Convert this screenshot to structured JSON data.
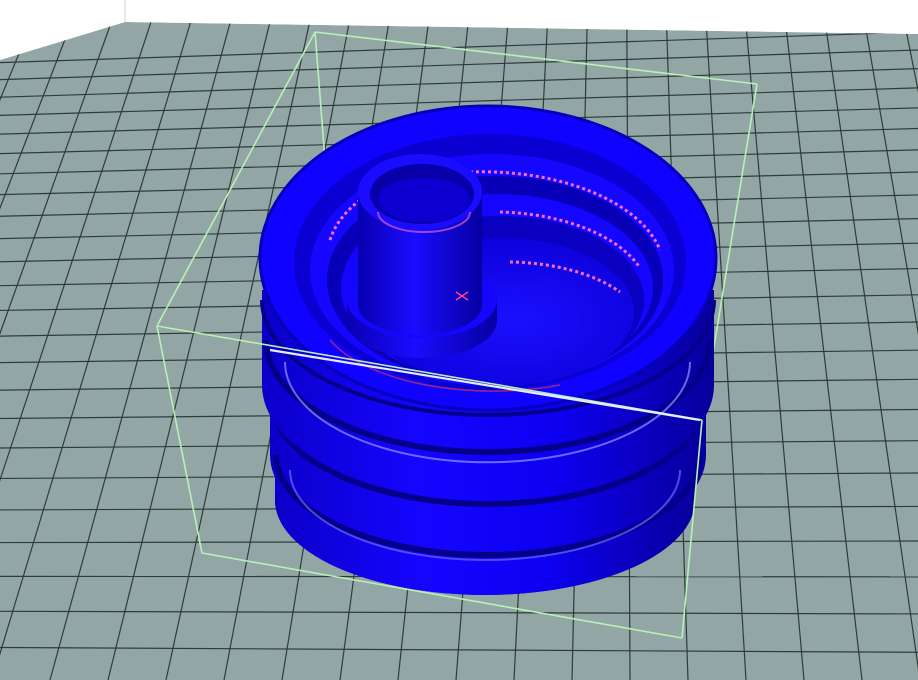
{
  "viewport": {
    "kind": "3d-print-preview",
    "background_color": "#ffffff",
    "bed_color": "#93a6a6",
    "grid_line_color": "#2f3b3b",
    "bounding_box_color": "#b8f0b8",
    "model_color": "#0b00ff",
    "model_shade_color": "#06009a",
    "overhang_highlight_color": "#ff6bd0",
    "highlight_line_color": "#dfe6ff"
  },
  "model": {
    "description_icon": "threaded-cap-with-center-tube-icon"
  }
}
